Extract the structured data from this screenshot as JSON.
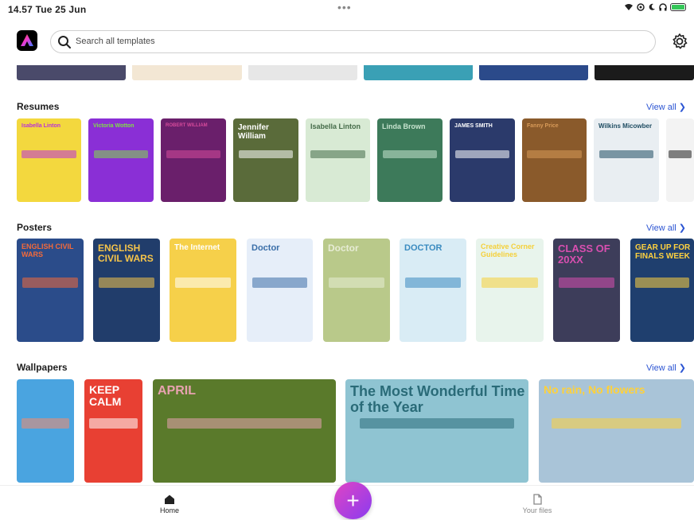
{
  "status": {
    "time": "14.57  Tue 25 Jun",
    "dots": "•••"
  },
  "search": {
    "placeholder": "Search all templates"
  },
  "sections": {
    "resumes": {
      "title": "Resumes",
      "view_all": "View all ❯"
    },
    "posters": {
      "title": "Posters",
      "view_all": "View all ❯"
    },
    "wallpapers": {
      "title": "Wallpapers",
      "view_all": "View all ❯"
    }
  },
  "resumes": [
    {
      "name": "Isabella Linton",
      "bg": "#f3d83e",
      "accent": "#b931d8"
    },
    {
      "name": "Victoria Wotton",
      "bg": "#8a2fd6",
      "accent": "#7fe045"
    },
    {
      "name": "ROBERT WILLIAM",
      "bg": "#6a1f6b",
      "accent": "#d64a9b"
    },
    {
      "name": "Jennifer William",
      "bg": "#5a6b3a",
      "accent": "#ffffff"
    },
    {
      "name": "Isabella Linton",
      "bg": "#d8ead4",
      "accent": "#456b49"
    },
    {
      "name": "Linda Brown",
      "bg": "#3d7a5a",
      "accent": "#c7e4cf"
    },
    {
      "name": "JAMES SMITH",
      "bg": "#2b3a6b",
      "accent": "#ffffff"
    },
    {
      "name": "Fanny Price",
      "bg": "#8a5a2b",
      "accent": "#d79a58"
    },
    {
      "name": "Wilkins Micowber",
      "bg": "#e9eef2",
      "accent": "#1e4c62"
    },
    {
      "name": "",
      "bg": "#f3f3f3",
      "accent": "#1e1e1e"
    }
  ],
  "posters": [
    {
      "name": "ENGLISH CIVIL WARS",
      "bg": "#2b4c8a",
      "accent": "#f46a3a"
    },
    {
      "name": "ENGLISH CIVIL WARS",
      "bg": "#213d6b",
      "accent": "#f5c44a"
    },
    {
      "name": "The Internet",
      "bg": "#f6d04a",
      "accent": "#ffffff"
    },
    {
      "name": "Doctor",
      "bg": "#e6eef9",
      "accent": "#3a6ea8"
    },
    {
      "name": "Doctor",
      "bg": "#b9c98a",
      "accent": "#e7ecd5"
    },
    {
      "name": "DOCTOR",
      "bg": "#d9ecf5",
      "accent": "#3a8bc0"
    },
    {
      "name": "Creative Corner Guidelines",
      "bg": "#e8f4ec",
      "accent": "#f5d03a"
    },
    {
      "name": "CLASS OF 20XX",
      "bg": "#3d3d5a",
      "accent": "#d94fb0"
    },
    {
      "name": "GEAR UP FOR FINALS WEEK",
      "bg": "#1f3f6e",
      "accent": "#ffd23f"
    }
  ],
  "wallpapers": [
    {
      "name": "",
      "bg": "#4aa4e0",
      "accent": "#f58a6b"
    },
    {
      "name": "KEEP CALM",
      "bg": "#e84033",
      "accent": "#ffffff"
    },
    {
      "name": "APRIL",
      "bg": "#5a7a2b",
      "accent": "#e8a3b0"
    },
    {
      "name": "The Most Wonderful Time of the Year",
      "bg": "#8fc4d2",
      "accent": "#2a6b78"
    },
    {
      "name": "No rain, No flowers",
      "bg": "#a9c4d8",
      "accent": "#ffd13a"
    }
  ],
  "nav": {
    "home": "Home",
    "files": "Your files",
    "fab": "+"
  },
  "colors": {
    "link": "#2c55d3",
    "fab_start": "#e044c4",
    "fab_end": "#8a3cf0"
  }
}
